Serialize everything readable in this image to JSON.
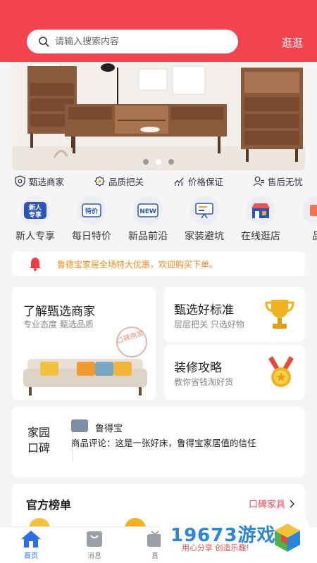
{
  "header": {
    "search_placeholder": "请输入搜索内容",
    "browse_label": "逛逛",
    "background_color": "#f2454f"
  },
  "banner": {
    "slides_count": 3,
    "active_slide": 2
  },
  "features": [
    {
      "label": "甄选商家",
      "icon": "shield-icon"
    },
    {
      "label": "品质把关",
      "icon": "quality-icon"
    },
    {
      "label": "价格保证",
      "icon": "price-chart-icon"
    },
    {
      "label": "售后无忧",
      "icon": "service-person-icon"
    }
  ],
  "categories": [
    {
      "label": "新人专享",
      "icon_text": "新人专享",
      "icon": "new-user-icon"
    },
    {
      "label": "每日特价",
      "icon_text": "特价",
      "icon": "special-price-icon"
    },
    {
      "label": "新品前沿",
      "icon_text": "NEW",
      "icon": "new-product-icon"
    },
    {
      "label": "家装避坑",
      "icon": "guide-board-icon"
    },
    {
      "label": "在线逛店",
      "icon": "store-icon"
    },
    {
      "label": "品",
      "icon": "more-category-icon"
    }
  ],
  "notice": {
    "text": "鲁德宝家居全场特大优惠，欢迎购买下单。",
    "icon": "bell-icon"
  },
  "promo": {
    "merchant": {
      "title": "了解甄选商家",
      "subtitle": "专业态度 甄选品质",
      "stamp": "口碑商家"
    },
    "standard": {
      "title": "甄选好标准",
      "subtitle": "层层把关 只选好物",
      "icon": "trophy-icon"
    },
    "guide": {
      "title": "装修攻略",
      "subtitle": "教你省钱淘好货",
      "icon": "medal-icon"
    }
  },
  "reviews": {
    "label_line1": "家园",
    "label_line2": "口碑",
    "user": "鲁得宝",
    "text": "商品评论：这是一张好床，鲁得宝家居值的信任"
  },
  "ranking": {
    "title": "官方榜单",
    "link": "口碑家具"
  },
  "tabbar": {
    "tabs": [
      {
        "label": "首页",
        "icon": "home-icon"
      },
      {
        "label": "消息",
        "icon": "message-icon"
      },
      {
        "label": "直",
        "icon": "live-icon"
      }
    ]
  },
  "watermark": {
    "title": "19673游戏",
    "slogan": "用心分享 创造乐趣!"
  }
}
